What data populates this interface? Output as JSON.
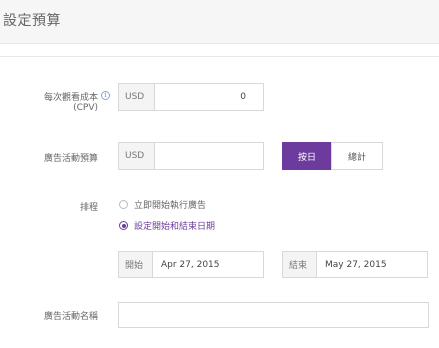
{
  "header": {
    "title": "設定預算"
  },
  "cpv": {
    "label_line1": "每次觀看成本",
    "label_line2": "(CPV)",
    "currency": "USD",
    "value": "0"
  },
  "budget": {
    "label": "廣告活動預算",
    "currency": "USD",
    "value": "",
    "daily_label": "按日",
    "total_label": "總計"
  },
  "schedule": {
    "label": "排程",
    "option_now": "立即開始執行廣告",
    "option_dates": "設定開始和結束日期",
    "start_prefix": "開始",
    "start_value": "Apr 27, 2015",
    "end_prefix": "結束",
    "end_value": "May 27, 2015"
  },
  "campaign_name": {
    "label": "廣告活動名稱",
    "value": ""
  },
  "colors": {
    "accent": "#6d3b9e",
    "info": "#6e8fcf"
  }
}
